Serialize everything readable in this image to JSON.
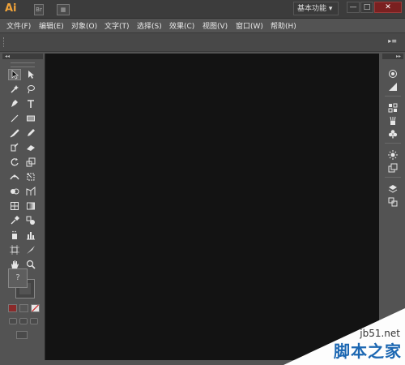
{
  "app": {
    "logo_text": "Ai"
  },
  "titlebar": {
    "workspace_label": "基本功能",
    "minimize": "—",
    "maximize": "□",
    "close": "✕"
  },
  "menu": [
    "文件(F)",
    "编辑(E)",
    "对象(O)",
    "文字(T)",
    "选择(S)",
    "效果(C)",
    "视图(V)",
    "窗口(W)",
    "帮助(H)"
  ],
  "toolbox": {
    "collapse": "◂◂",
    "fill_stroke_symbol": "?"
  },
  "rightdock": {
    "collapse": "▸▸"
  },
  "watermark": {
    "site": "jb51.net",
    "name": "脚本之家"
  }
}
